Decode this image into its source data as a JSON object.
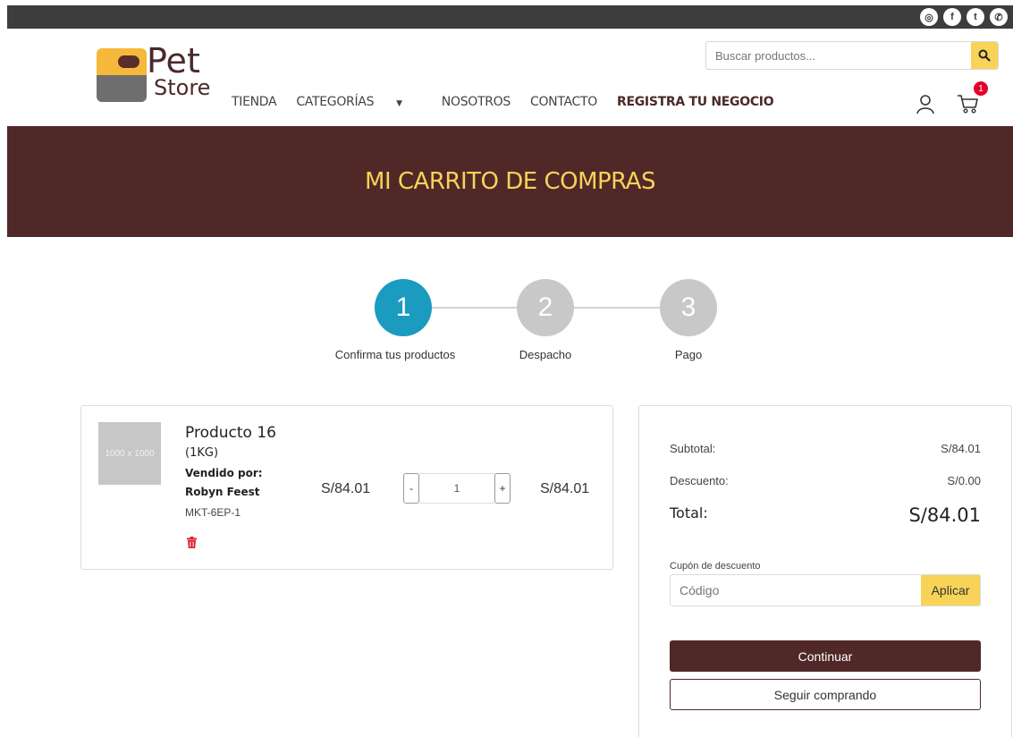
{
  "social": {
    "icons": [
      "instagram-icon",
      "facebook-icon",
      "twitter-icon",
      "whatsapp-icon"
    ]
  },
  "logo": {
    "line1": "Pet",
    "line2": "Store"
  },
  "nav": {
    "tienda": "TIENDA",
    "categorias": "CATEGORÍAS",
    "nosotros": "NOSOTROS",
    "contacto": "CONTACTO",
    "registra": "REGISTRA TU NEGOCIO"
  },
  "search": {
    "placeholder": "Buscar productos..."
  },
  "cart": {
    "count": "1"
  },
  "banner": {
    "title": "MI CARRITO DE COMPRAS"
  },
  "steps": [
    {
      "number": "1",
      "label": "Confirma tus productos",
      "active": true
    },
    {
      "number": "2",
      "label": "Despacho",
      "active": false
    },
    {
      "number": "3",
      "label": "Pago",
      "active": false
    }
  ],
  "item": {
    "thumb_text": "1000 x 1000",
    "name": "Producto 16",
    "weight": "(1KG)",
    "seller_label": "Vendido por:",
    "seller": "Robyn Feest",
    "sku": "MKT-6EP-1",
    "price": "S/84.01",
    "quantity": "1",
    "minus": "-",
    "plus": "+",
    "line_total": "S/84.01"
  },
  "summary": {
    "subtotal_label": "Subtotal:",
    "subtotal": "S/84.01",
    "discount_label": "Descuento:",
    "discount": "S/0.00",
    "total_label": "Total:",
    "total": "S/84.01",
    "coupon_label": "Cupón de descuento",
    "coupon_placeholder": "Código",
    "apply": "Aplicar",
    "continue": "Continuar",
    "keep_shopping": "Seguir comprando"
  },
  "colors": {
    "brand": "#502828",
    "accent": "#f7d358",
    "step_active": "#1a9bbf",
    "step_inactive": "#c8c8c8",
    "badge": "#e3002a"
  }
}
